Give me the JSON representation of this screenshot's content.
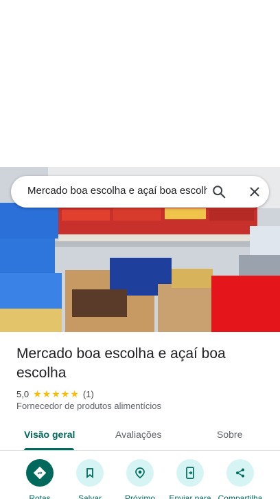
{
  "search": {
    "query": "Mercado boa escolha e açaí boa escolha"
  },
  "place": {
    "title": "Mercado boa escolha e açaí boa escolha",
    "rating": "5,0",
    "stars": 5,
    "review_count": "(1)",
    "category": "Fornecedor de produtos alimentícios"
  },
  "tabs": [
    {
      "label": "Visão geral",
      "active": true
    },
    {
      "label": "Avaliações",
      "active": false
    },
    {
      "label": "Sobre",
      "active": false
    }
  ],
  "actions": [
    {
      "label": "Rotas",
      "icon": "directions-icon"
    },
    {
      "label": "Salvar",
      "icon": "bookmark-icon"
    },
    {
      "label": "Próximo",
      "icon": "nearby-icon"
    },
    {
      "label": "Enviar para",
      "icon": "send-to-phone-icon"
    },
    {
      "label": "Compartilha",
      "icon": "share-icon"
    }
  ],
  "colors": {
    "accent": "#00695c",
    "action_bg": "#d7f4f5",
    "star": "#fbbc04"
  }
}
